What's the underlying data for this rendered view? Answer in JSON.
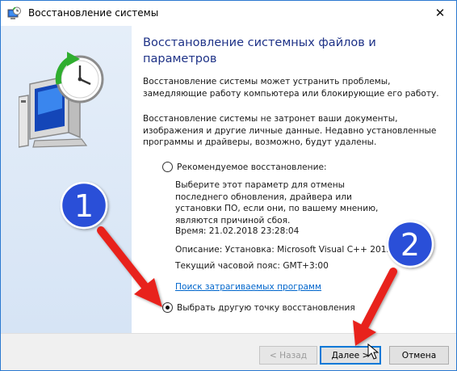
{
  "window": {
    "title": "Восстановление системы",
    "close_glyph": "✕"
  },
  "content": {
    "heading": "Восстановление системных файлов и параметров",
    "para1": "Восстановление системы может устранить проблемы, замедляющие работу компьютера или блокирующие его работу.",
    "para2": "Восстановление системы не затронет ваши документы, изображения и другие личные данные. Недавно установленные программы и драйверы, возможно, будут удалены."
  },
  "options": {
    "recommended": {
      "label": "Рекомендуемое восстановление:",
      "selected": false,
      "description": "Выберите этот параметр для отмены последнего обновления, драйвера или установки ПО, если они, по вашему мнению, являются причиной сбоя.",
      "time": "Время: 21.02.2018 23:28:04",
      "description_line": "Описание: Установка: Microsoft Visual C++ 2013 Re...",
      "timezone": "Текущий часовой пояс: GMT+3:00",
      "affected_link": "Поиск затрагиваемых программ"
    },
    "other": {
      "label": "Выбрать другую точку восстановления",
      "selected": true
    }
  },
  "buttons": {
    "back": "< Назад",
    "next": "Далее >",
    "cancel": "Отмена"
  },
  "annotations": {
    "marker1": "1",
    "marker2": "2"
  },
  "colors": {
    "heading": "#1e3287",
    "link": "#0066cc",
    "marker": "#2a4fd8",
    "arrow": "#e8241c"
  }
}
